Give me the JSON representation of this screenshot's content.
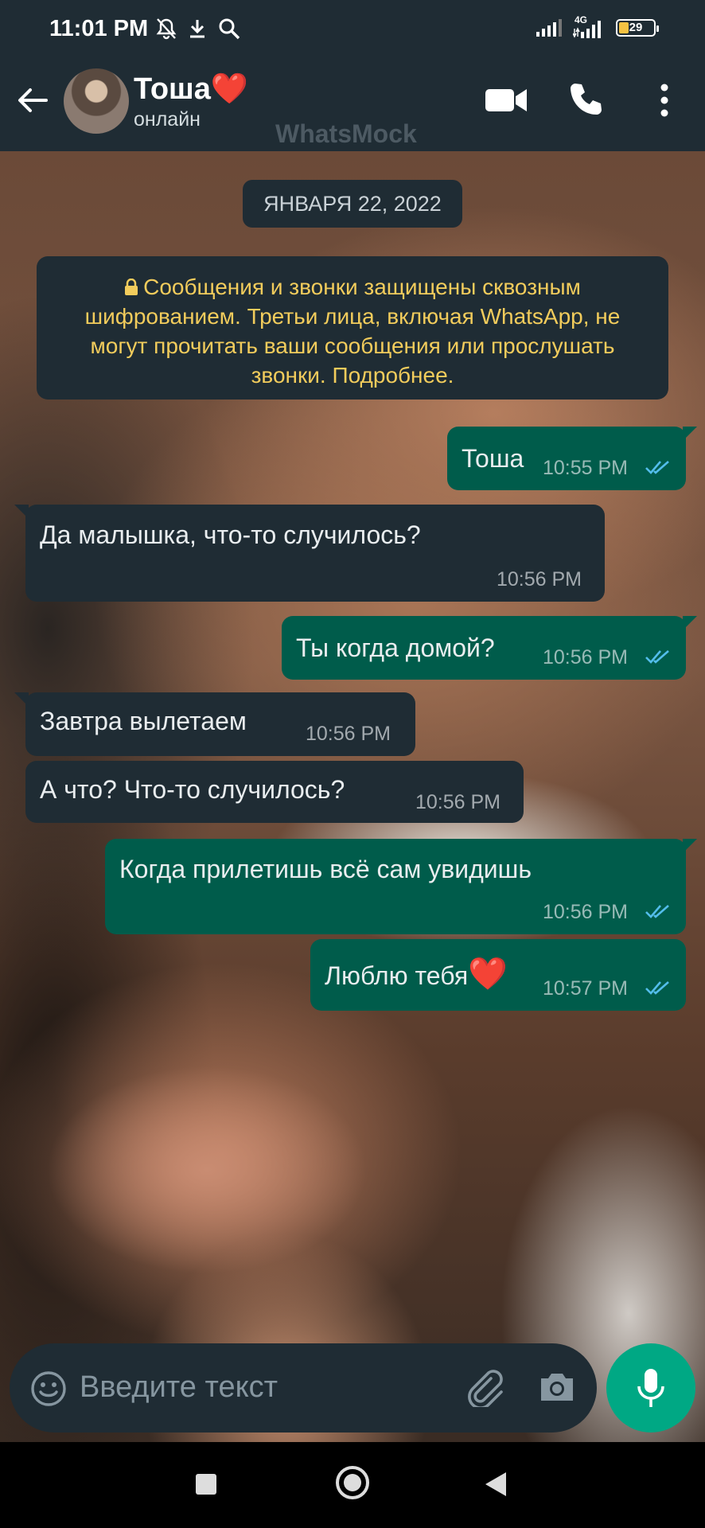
{
  "status_bar": {
    "time": "11:01 PM",
    "network": "4G",
    "battery": "29"
  },
  "header": {
    "contact_name": "Тоша",
    "name_emoji": "❤️",
    "contact_status": "онлайн",
    "watermark": "WhatsMock",
    "icons": [
      "back-arrow-icon",
      "video-call-icon",
      "phone-call-icon",
      "more-vert-icon"
    ]
  },
  "chat": {
    "date_label": "ЯНВАРЯ 22, 2022",
    "encryption_notice": "Сообщения и звонки защищены сквозным шифрованием. Третьи лица, включая WhatsApp, не могут прочитать ваши сообщения или прослушать звонки. Подробнее.",
    "messages": [
      {
        "direction": "out",
        "text": "Тоша",
        "time": "10:55 PM",
        "read": true
      },
      {
        "direction": "in",
        "text": "Да малышка, что-то случилось?",
        "time": "10:56 PM"
      },
      {
        "direction": "out",
        "text": "Ты когда домой?",
        "time": "10:56 PM",
        "read": true
      },
      {
        "direction": "in",
        "text": "Завтра вылетаем",
        "time": "10:56 PM"
      },
      {
        "direction": "in",
        "text": "А что? Что-то случилось?",
        "time": "10:56 PM"
      },
      {
        "direction": "out",
        "text": "Когда прилетишь всё сам увидишь",
        "time": "10:56 PM",
        "read": true
      },
      {
        "direction": "out",
        "text": "Люблю тебя",
        "emoji": "❤️",
        "time": "10:57 PM",
        "read": true
      }
    ]
  },
  "input": {
    "placeholder": "Введите текст"
  },
  "colors": {
    "bar_bg": "#1f2c34",
    "outgoing_bubble": "#005c4b",
    "incoming_bubble": "#1f2c34",
    "encryption_text": "#f2cc5c",
    "read_ticks": "#53bdeb",
    "mic_button": "#00a884"
  }
}
